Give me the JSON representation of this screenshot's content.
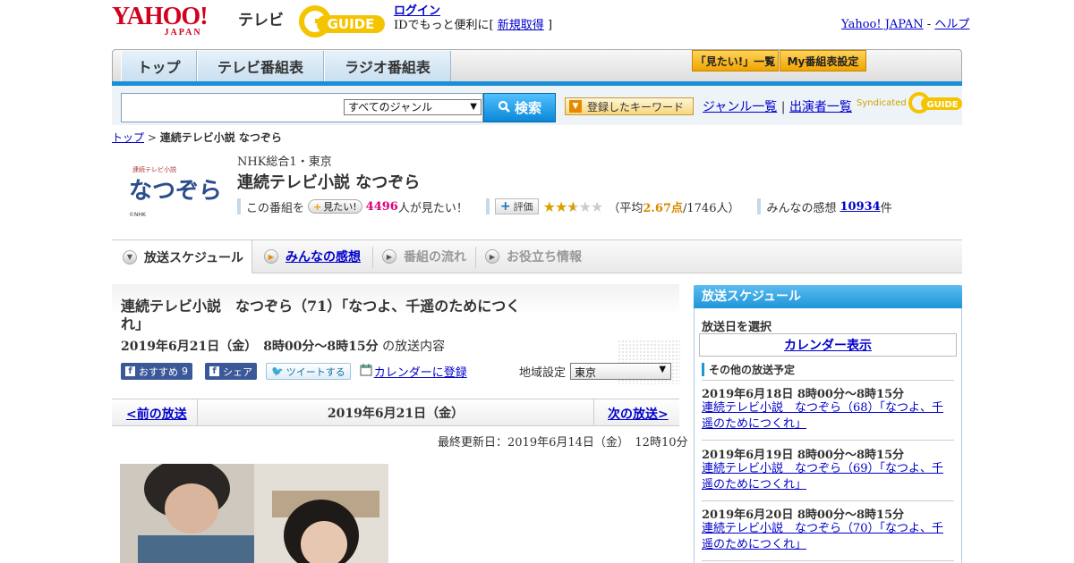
{
  "header": {
    "yahoo_logo": "YAHOO!",
    "yahoo_logo_sub": "JAPAN",
    "tv_label": "テレビ",
    "gguide_logo": "GUIDE",
    "login": "ログイン",
    "login_note_prefix": "IDでもっと便利に[",
    "signup": "新規取得",
    "login_note_suffix": "]",
    "yahoo_japan_link": "Yahoo! JAPAN",
    "link_sep": "-",
    "help_link": "ヘルプ"
  },
  "nav": {
    "tabs": [
      "トップ",
      "テレビ番組表",
      "ラジオ番組表"
    ],
    "mitai_list": "「見たい!」一覧",
    "my_bangumi": "My番組表設定"
  },
  "search": {
    "placeholder": "",
    "genre_selected": "すべてのジャンル",
    "button": "検索",
    "keyword_button": "登録したキーワード",
    "genre_list": "ジャンル一覧",
    "sep": "|",
    "performer_list": "出演者一覧",
    "syndicated": "Syndicated"
  },
  "breadcrumb": {
    "top": "トップ",
    "sep": ">",
    "current": "連続テレビ小説 なつぞら"
  },
  "program": {
    "channel": "NHK総合1・東京",
    "title": "連続テレビ小説 なつぞら",
    "logo_text": "なつぞら",
    "logo_small": "連続テレビ小説",
    "logo_copy": "©NHK",
    "kono_bangumi": "この番組を",
    "mitai_button": "見たい!",
    "mitai_count": "4496",
    "mitai_suffix": "人が見たい！",
    "hyouka_button": "評価",
    "rating": 2.67,
    "avg_prefix": "（平均",
    "avg_value": "2.67点",
    "avg_suffix": "/1746人）",
    "kansou_label": "みんなの感想",
    "kansou_count": "10934",
    "kansou_suffix": "件"
  },
  "subtabs": {
    "schedule": "放送スケジュール",
    "kansou": "みんなの感想",
    "nagare": "番組の流れ",
    "oyaku": "お役立ち情報"
  },
  "episode": {
    "title": "連続テレビ小説　なつぞら（71）「なつよ、千遥のためにつくれ」",
    "date_time": "2019年6月21日（金）　8時00分～8時15分",
    "content_suffix": "の放送内容",
    "fb_recommend": "おすすめ",
    "fb_count": "9",
    "fb_share": "シェア",
    "tweet": "ツイートする",
    "calendar": "カレンダーに登録",
    "region_label": "地域設定",
    "region_selected": "東京",
    "prev": "<前の放送",
    "current_date": "2019年6月21日（金）",
    "next": "次の放送>",
    "last_updated": "最終更新日：2019年6月14日（金）　12時10分"
  },
  "sidebar": {
    "header": "放送スケジュール",
    "select_label": "放送日を選択",
    "calendar_button": "カレンダー表示",
    "other_label": "その他の放送予定",
    "items": [
      {
        "date": "2019年6月18日  8時00分～8時15分",
        "link": "連続テレビ小説　なつぞら（68）「なつよ、千遥のためにつくれ」"
      },
      {
        "date": "2019年6月19日  8時00分～8時15分",
        "link": "連続テレビ小説　なつぞら（69）「なつよ、千遥のためにつくれ」"
      },
      {
        "date": "2019年6月20日  8時00分～8時15分",
        "link": "連続テレビ小説　なつぞら（70）「なつよ、千遥のためにつくれ」"
      }
    ]
  },
  "colors": {
    "yahoo_red": "#d1001c",
    "nav_blue": "#1a8fd6",
    "link": "#0000cc",
    "pink": "#e0007c",
    "star": "#d7a100"
  }
}
